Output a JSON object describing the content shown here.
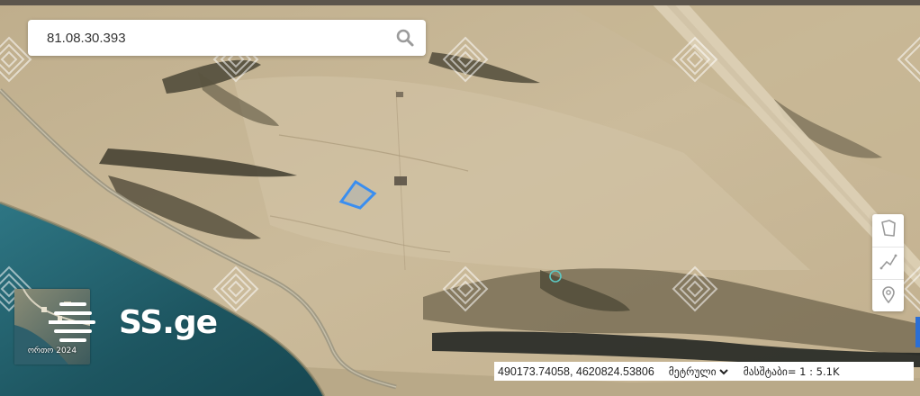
{
  "search": {
    "value": "81.08.30.393",
    "icon": "search-icon"
  },
  "tools": [
    {
      "name": "draw-polygon-tool",
      "icon": "polygon-icon"
    },
    {
      "name": "measure-line-tool",
      "icon": "line-measure-icon"
    },
    {
      "name": "place-marker-tool",
      "icon": "location-pin-icon"
    }
  ],
  "status": {
    "coordinates": "490173.74058, 4620824.53806",
    "unit_selected": "მეტრული",
    "unit_options": [
      "მეტრული"
    ],
    "scale_text": "მასშტაბი= 1 : 5.1K"
  },
  "layer": {
    "label": "ორთო 2024"
  },
  "logo": {
    "text": "SS.ge"
  },
  "colors": {
    "parcel_outline": "#3a8ef0",
    "marker_circle": "#5cc7c2",
    "water": "#1f5a64",
    "terrain": "#c8b795",
    "status_bg": "#ffffff",
    "accent_blue": "#2b6fd6"
  }
}
